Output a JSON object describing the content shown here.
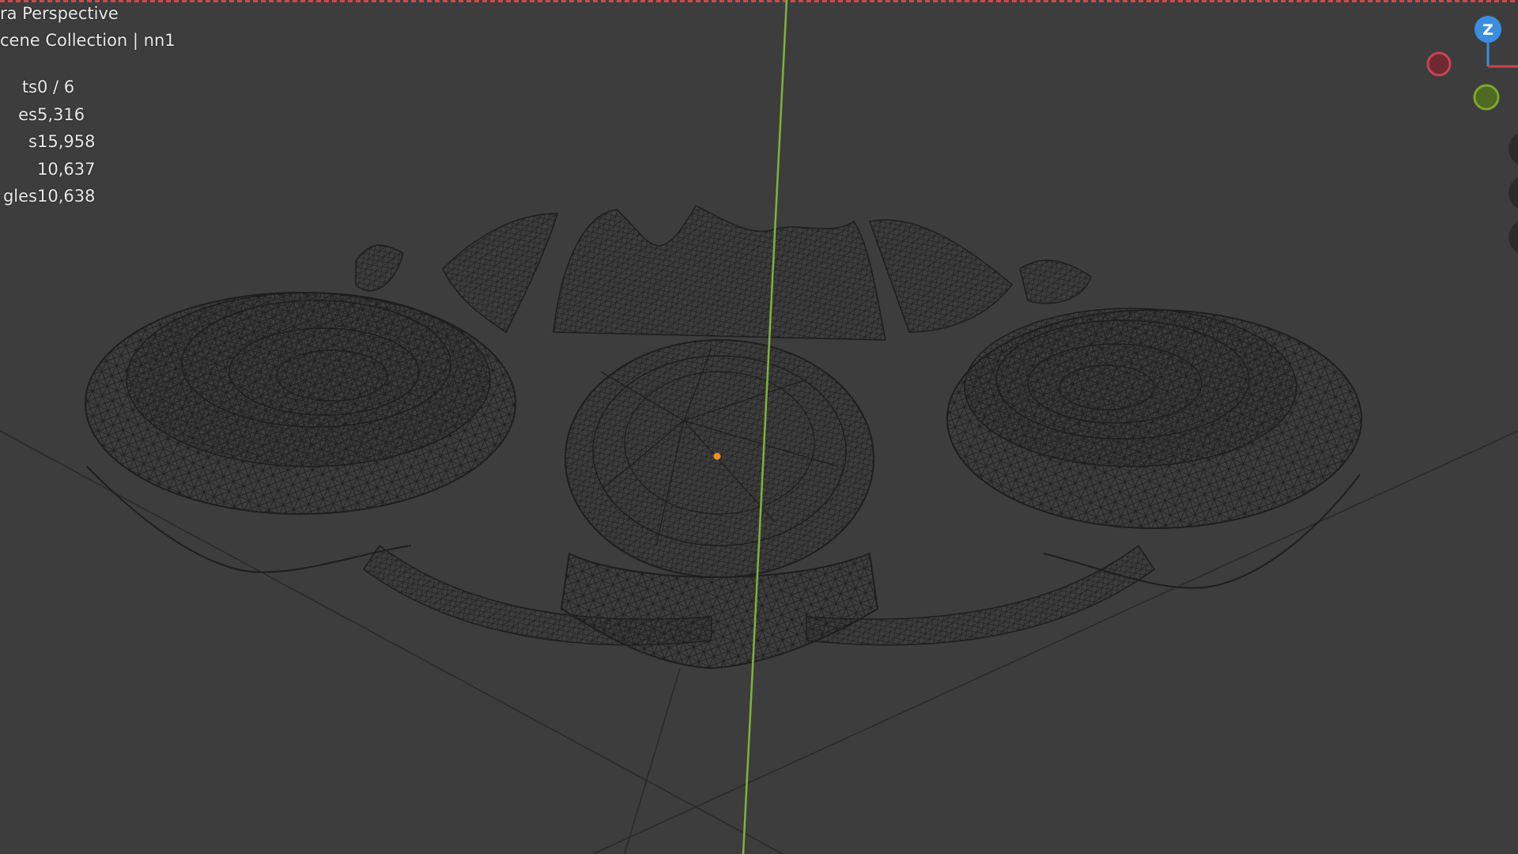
{
  "viewport": {
    "view_name": "ra Perspective",
    "collection_label": "cene Collection | nn1"
  },
  "stats": [
    {
      "label": "ts",
      "value": "0 / 6"
    },
    {
      "label": "es",
      "value": "5,316"
    },
    {
      "label": "s",
      "value": "15,958"
    },
    {
      "label": "",
      "value": "10,637"
    },
    {
      "label": "gles",
      "value": "10,638"
    }
  ],
  "gizmo": {
    "z_label": "Z",
    "colors": {
      "x": "#c8454f",
      "y": "#7aa82a",
      "z": "#3b8de0"
    }
  },
  "colors": {
    "background": "#3d3d3d",
    "wireframe": "#1f1f1f",
    "y_axis_line": "#7fb33b",
    "origin_dot": "#f0901e"
  }
}
